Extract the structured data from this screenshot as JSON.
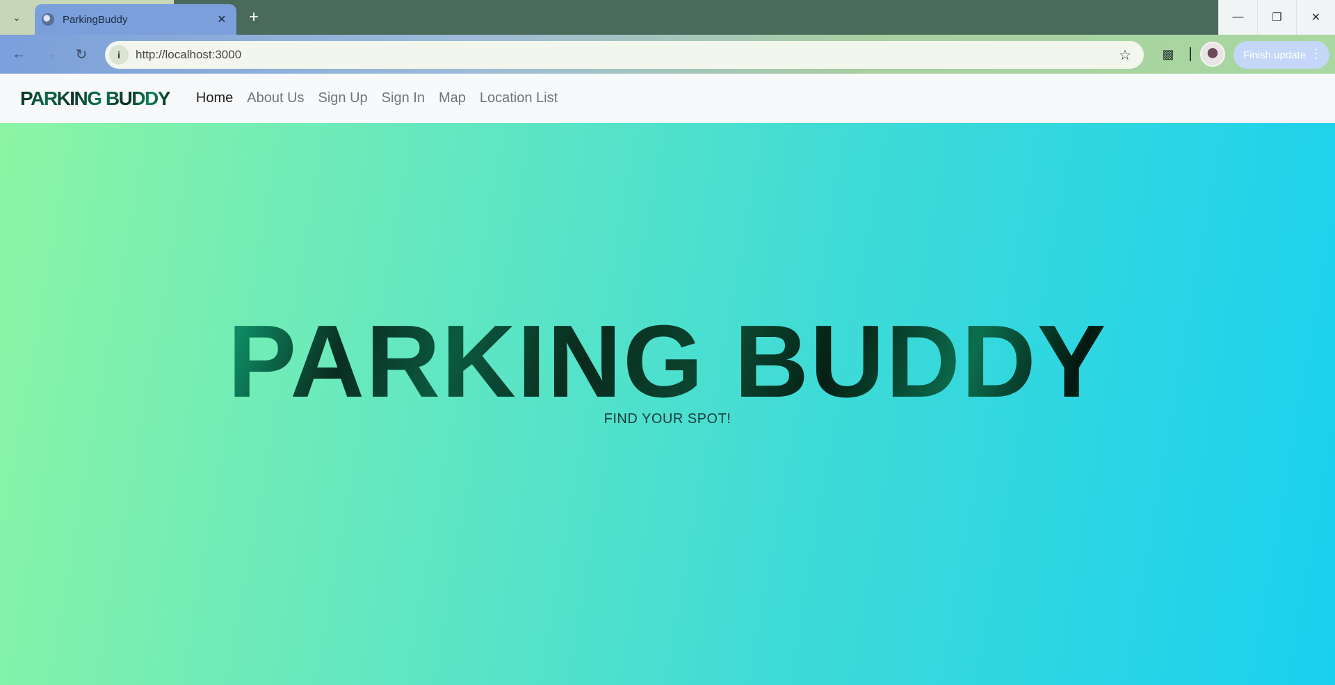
{
  "browser": {
    "tab_title": "ParkingBuddy",
    "url": "http://localhost:3000",
    "update_label": "Finish update"
  },
  "site_nav": {
    "brand": "PARKING BUDDY",
    "links": [
      "Home",
      "About Us",
      "Sign Up",
      "Sign In",
      "Map",
      "Location List"
    ],
    "active": "Home"
  },
  "hero": {
    "title": "PARKING BUDDY",
    "subtitle": "FIND YOUR SPOT!"
  },
  "colors": {
    "hero_gradient_start": "#8cf5a4",
    "hero_gradient_end": "#1ad0ef",
    "brand_text": "#0a6b4c",
    "nav_background": "#f8f9fa"
  }
}
